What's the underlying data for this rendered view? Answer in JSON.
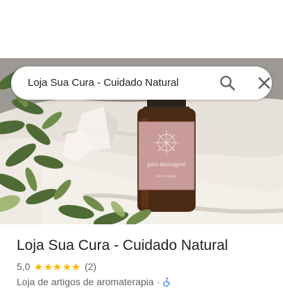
{
  "search": {
    "query": "Loja Sua Cura - Cuidado Natural",
    "search_icon": "search-icon",
    "close_icon": "close-icon"
  },
  "hero": {
    "bottle_label": "para massagem",
    "bottle_sublabel": "óleo vegetal"
  },
  "place": {
    "title": "Loja Sua Cura - Cuidado Natural",
    "rating": "5,0",
    "stars": 5,
    "reviews": "(2)",
    "category": "Loja de artigos de aromaterapia",
    "separator": "·",
    "accessibility_icon": "wheelchair-icon"
  },
  "colors": {
    "star": "#fbbc04",
    "accessibility": "#1a73e8",
    "text_primary": "#202124",
    "text_secondary": "#5f6368",
    "bottle": "#4a2a14",
    "label": "#c99a9a"
  }
}
